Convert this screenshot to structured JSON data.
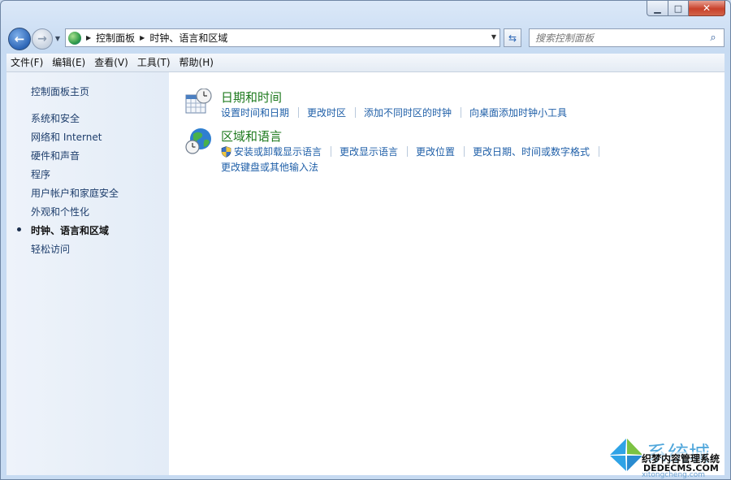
{
  "window": {
    "caption": {
      "minimize": "▁",
      "maximize": "□",
      "close": "✕"
    }
  },
  "nav": {
    "back_glyph": "←",
    "forward_glyph": "→",
    "history_glyph": "▼",
    "breadcrumbs": [
      "控制面板",
      "时钟、语言和区域"
    ],
    "crumb_arrow": "▶",
    "address_dropdown_glyph": "▼",
    "refresh_glyph": "⇆",
    "search_placeholder": "搜索控制面板",
    "search_glyph": "⌕"
  },
  "menubar": {
    "items": [
      "文件(F)",
      "编辑(E)",
      "查看(V)",
      "工具(T)",
      "帮助(H)"
    ]
  },
  "sidebar": {
    "home": "控制面板主页",
    "items": [
      {
        "label": "系统和安全",
        "active": false
      },
      {
        "label": "网络和 Internet",
        "active": false
      },
      {
        "label": "硬件和声音",
        "active": false
      },
      {
        "label": "程序",
        "active": false
      },
      {
        "label": "用户帐户和家庭安全",
        "active": false
      },
      {
        "label": "外观和个性化",
        "active": false
      },
      {
        "label": "时钟、语言和区域",
        "active": true
      },
      {
        "label": "轻松访问",
        "active": false
      }
    ]
  },
  "categories": [
    {
      "title": "日期和时间",
      "icon": "calendar-clock-icon",
      "tasks": [
        "设置时间和日期",
        "更改时区",
        "添加不同时区的时钟",
        "向桌面添加时钟小工具"
      ]
    },
    {
      "title": "区域和语言",
      "icon": "globe-clock-icon",
      "tasks": [
        "安装或卸载显示语言",
        "更改显示语言",
        "更改位置",
        "更改日期、时间或数字格式"
      ],
      "tasks_line2": [
        "更改键盘或其他输入法"
      ]
    }
  ],
  "watermark": {
    "brand": "系统城",
    "line1": "织梦内容管理系统",
    "line2": "DEDECMS.COM",
    "line3": "xitongcheng.com"
  },
  "colors": {
    "category_title": "#1e7a1e",
    "task_link": "#1f5fa8",
    "sidebar_link": "#1e3e6c",
    "close_button": "#c8412a"
  }
}
